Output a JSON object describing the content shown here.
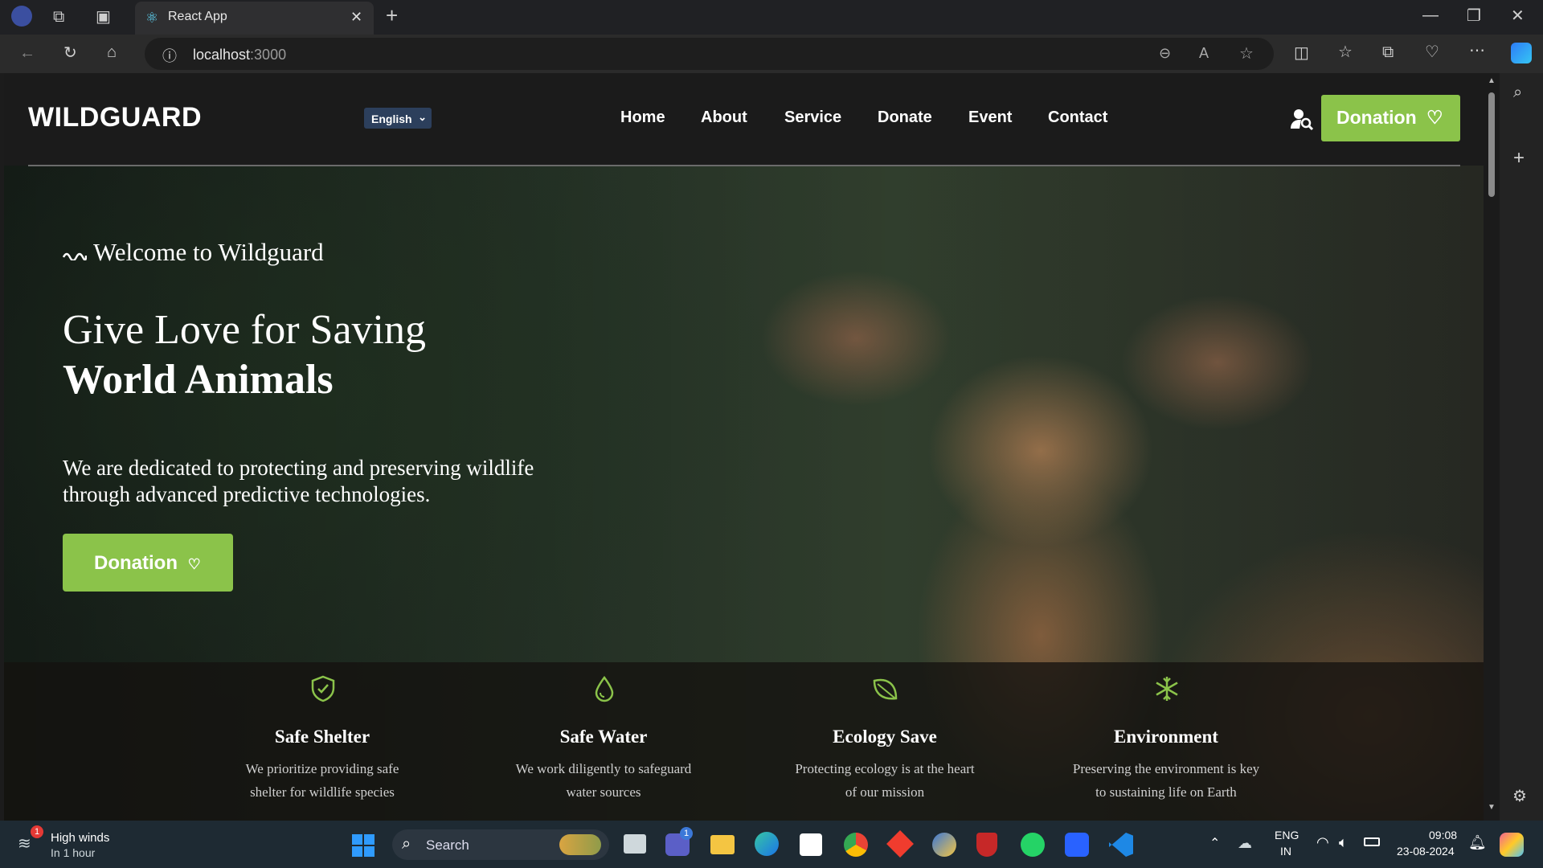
{
  "browser": {
    "tab_title": "React App",
    "url_host": "localhost",
    "url_port": ":3000"
  },
  "nav": {
    "brand": "WILDGUARD",
    "language": "English",
    "links": [
      "Home",
      "About",
      "Service",
      "Donate",
      "Event",
      "Contact"
    ],
    "donate_button": "Donation"
  },
  "hero": {
    "welcome": "Welcome to Wildguard",
    "headline_line1": "Give Love for Saving",
    "headline_line2": "World Animals",
    "description": "We are dedicated to protecting and preserving wildlife through advanced predictive technologies.",
    "cta": "Donation"
  },
  "features": [
    {
      "icon": "shield-check-icon",
      "title": "Safe Shelter",
      "desc_line1": "We prioritize providing safe",
      "desc_line2": "shelter for wildlife species"
    },
    {
      "icon": "water-drop-icon",
      "title": "Safe Water",
      "desc_line1": "We work diligently to safeguard",
      "desc_line2": "water sources"
    },
    {
      "icon": "leaf-icon",
      "title": "Ecology Save",
      "desc_line1": "Protecting ecology is at the heart",
      "desc_line2": "of our mission"
    },
    {
      "icon": "snowflake-icon",
      "title": "Environment",
      "desc_line1": "Preserving the environment is key",
      "desc_line2": "to sustaining life on Earth"
    }
  ],
  "colors": {
    "accent": "#8bc34a",
    "nav_bg": "#1b1b1b"
  },
  "taskbar": {
    "weather_title": "High winds",
    "weather_sub": "In 1 hour",
    "weather_badge": "1",
    "search": "Search",
    "teams_badge": "1",
    "lang_line1": "ENG",
    "lang_line2": "IN",
    "time": "09:08",
    "date": "23-08-2024"
  }
}
